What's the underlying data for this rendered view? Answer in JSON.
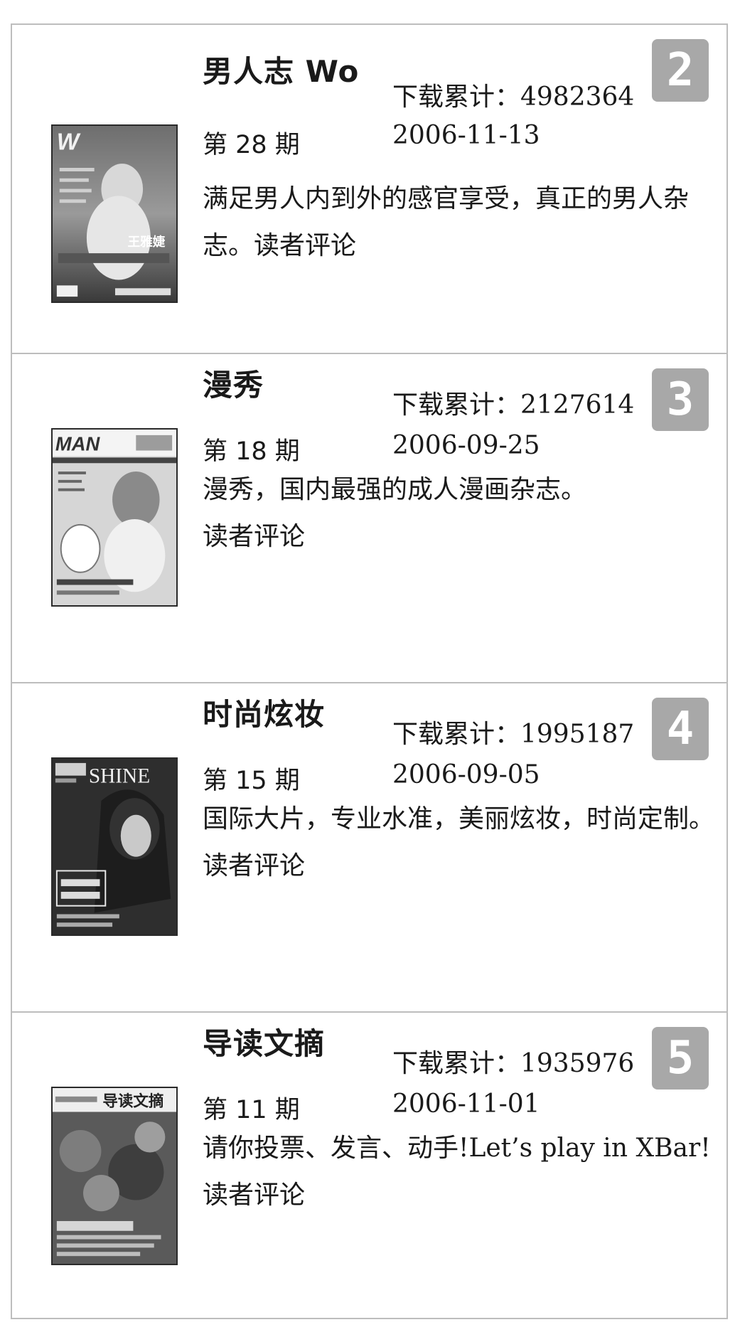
{
  "magazines": [
    {
      "rank": "2",
      "title": "男人志 Wo",
      "issue": "第 28 期",
      "downloads": "下载累计：4982364",
      "date": "2006-11-13",
      "description": "满足男人内到外的感官享受，真正的男人杂志。",
      "comments_label": "读者评论",
      "cover_text": "王雅婕"
    },
    {
      "rank": "3",
      "title": "漫秀",
      "issue": "第 18 期",
      "downloads": "下载累计：2127614",
      "date": "2006-09-25",
      "description": "漫秀，国内最强的成人漫画杂志。",
      "comments_label": "读者评论",
      "cover_text": "MAN"
    },
    {
      "rank": "4",
      "title": "时尚炫妆",
      "issue": "第 15 期",
      "downloads": "下载累计：1995187",
      "date": "2006-09-05",
      "description": "国际大片，专业水准，美丽炫妆，时尚定制。",
      "comments_label": "读者评论",
      "cover_text": "SHINE"
    },
    {
      "rank": "5",
      "title": "导读文摘",
      "issue": "第 11 期",
      "downloads": "下载累计：1935976",
      "date": "2006-11-01",
      "description": "请你投票、发言、动手!Let’s play in XBar!",
      "comments_label": "读者评论",
      "cover_text": "导读文摘"
    }
  ]
}
